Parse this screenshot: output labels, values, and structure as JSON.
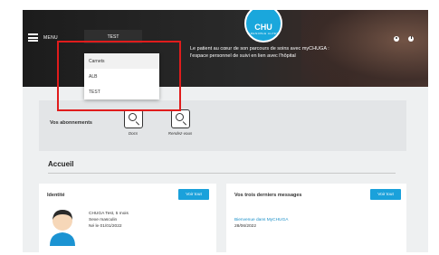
{
  "header": {
    "menu_label": "MENU",
    "carnet_button": "TEST",
    "logo_text": "CHU",
    "logo_subtext": "GRENOBLE ALPES",
    "tagline": "Le patient au cœur de son parcours de soins avec myCHUGA : l'espace personnel de suivi en lien avec l'hôpital"
  },
  "dropdown": {
    "header": "Carnets",
    "items": [
      "ALB",
      "TEST"
    ]
  },
  "subscriptions": {
    "label": "Vos abonnements",
    "items": [
      {
        "caption": "Docs",
        "icon": "search-document-icon"
      },
      {
        "caption": "Rendez-vous",
        "icon": "search-appointment-icon"
      }
    ]
  },
  "home": {
    "title": "Accueil"
  },
  "identity_card": {
    "title": "Identité",
    "button": "Voir tout",
    "name": "CHUGA Test, 5 mois",
    "sex": "Sexe masculin",
    "birth": "Né le 01/01/2022"
  },
  "messages_card": {
    "title": "Vos trois derniers messages",
    "button": "Voir tout",
    "message_title": "Bienvenue dans MyCHUGA",
    "message_date": "28/06/2022"
  },
  "colors": {
    "accent": "#1aa1db",
    "highlight": "#e01c1c",
    "topbar": "#1c1c1c"
  }
}
